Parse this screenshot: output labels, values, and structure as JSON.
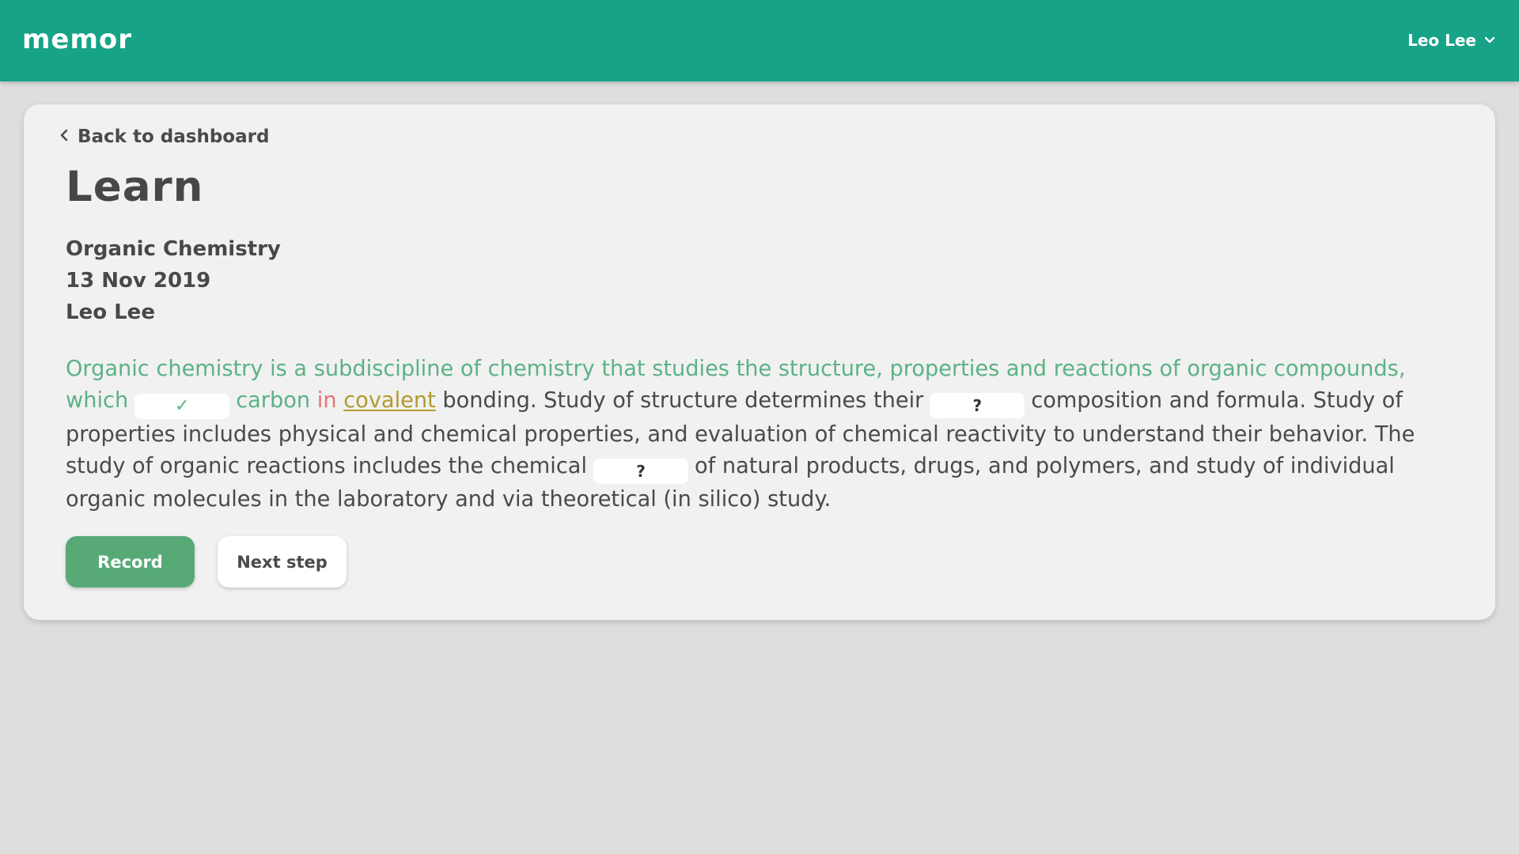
{
  "app": {
    "logo": "memor",
    "user_name": "Leo Lee",
    "colors": {
      "brand": "#17a387",
      "learned": "#5cb286",
      "wrong": "#e37474",
      "partial": "#b19b2e",
      "record_button": "#57aa76"
    }
  },
  "nav": {
    "back_label": "Back to dashboard",
    "back_icon": "chevron-left-icon",
    "user_menu_icon": "chevron-down-icon"
  },
  "page": {
    "title": "Learn",
    "course": "Organic Chemistry",
    "date": "13 Nov 2019",
    "author": "Leo Lee"
  },
  "passage": {
    "s1": "Organic chemistry is a subdiscipline of chemistry that studies the structure, properties and reactions of organic compounds, which",
    "blank1": "✓",
    "s2": "carbon",
    "s3": "in",
    "s4": "covalent",
    "s5": "bonding. Study of structure determines their",
    "blank2": "?",
    "s6": "composition and formula. Study of properties includes physical and chemical properties, and evaluation of chemical reactivity to understand their behavior. The study of organic reactions includes the chemical",
    "blank3": "?",
    "s7": "of natural products, drugs, and polymers, and study of individual organic molecules in the laboratory and via theoretical (in silico) study."
  },
  "actions": {
    "record_label": "Record",
    "next_label": "Next step"
  }
}
